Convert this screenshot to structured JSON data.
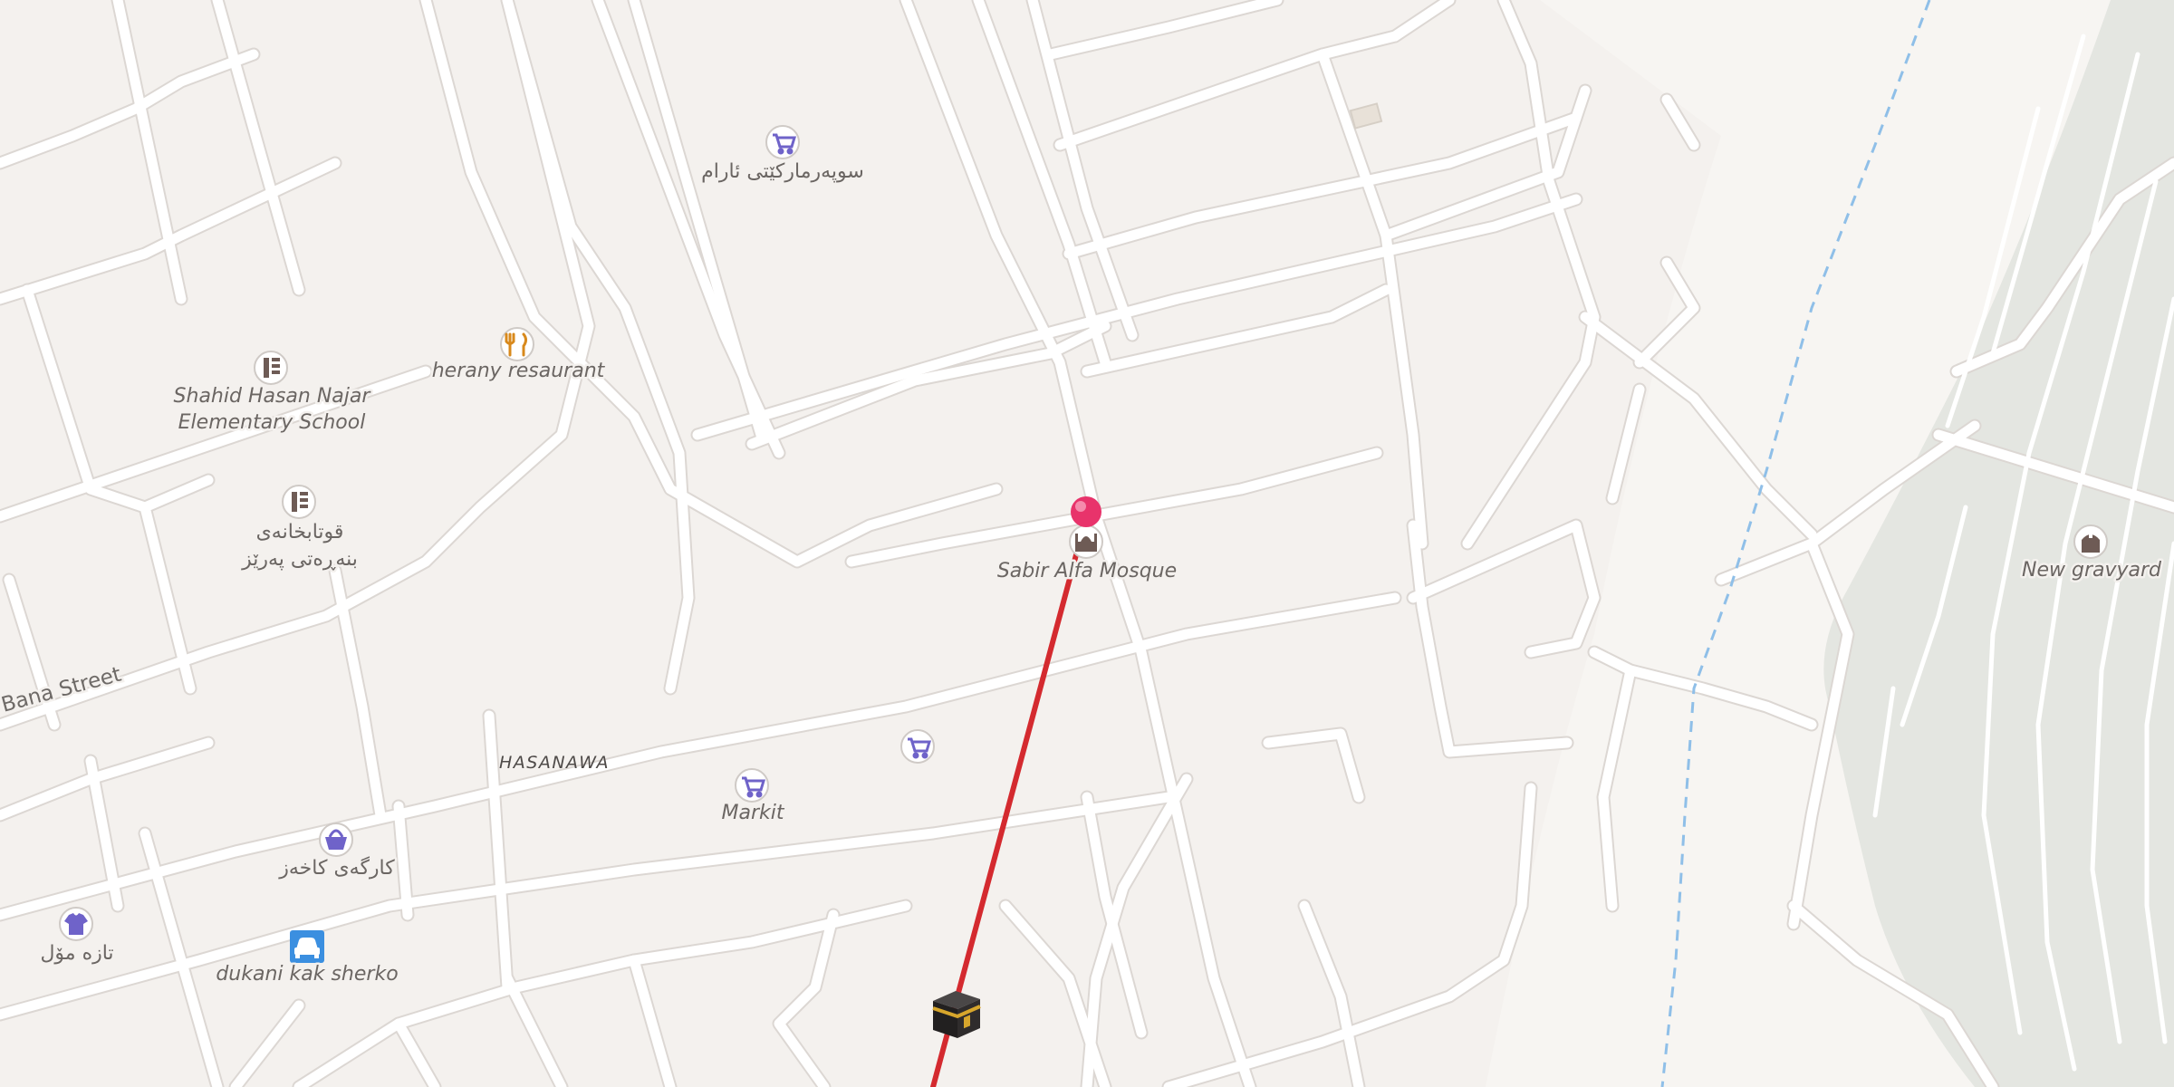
{
  "map": {
    "colors": {
      "land": "#f4f1ee",
      "road": "#ffffff",
      "road_casing": "#dcd7d3",
      "cemetery": "#e4e6e1",
      "route": "#d42a2f",
      "pin": "#e8336b",
      "water_dash": "#8fbfe8",
      "poi_shop": "#6f63c9",
      "poi_food": "#d8891c",
      "poi_civic": "#6e5b55",
      "poi_car": "#3b8fe0"
    },
    "area_label": "HASANAWA",
    "street_label": "Bana Street",
    "pois": [
      {
        "name": "سوپەرمارکێتی ئارام",
        "icon": "shopping-cart-icon"
      },
      {
        "name": "herany resaurant",
        "icon": "fork-knife-icon"
      },
      {
        "name": "Shahid Hasan Najar",
        "name2": "Elementary School",
        "icon": "school-icon"
      },
      {
        "name": "قوتابخانەی",
        "name2": "بنەڕەتی پەرێز",
        "icon": "school-icon"
      },
      {
        "name": "Sabir Alfa Mosque",
        "icon": "mosque-icon"
      },
      {
        "name": "New gravyard",
        "icon": "cemetery-icon"
      },
      {
        "name": "Markit",
        "icon": "shopping-cart-icon"
      },
      {
        "name": "",
        "icon": "shopping-cart-icon"
      },
      {
        "name": "کارگەی کاخەز",
        "icon": "shopping-basket-icon"
      },
      {
        "name": "تازە مۆل",
        "icon": "clothing-shirt-icon"
      },
      {
        "name": "dukani kak sherko",
        "icon": "car-icon"
      }
    ],
    "markers": [
      {
        "name": "location-pin",
        "icon": "map-pin-icon"
      },
      {
        "name": "qibla",
        "icon": "kaaba-icon"
      }
    ],
    "route": {
      "type": "qibla-direction-line"
    }
  }
}
